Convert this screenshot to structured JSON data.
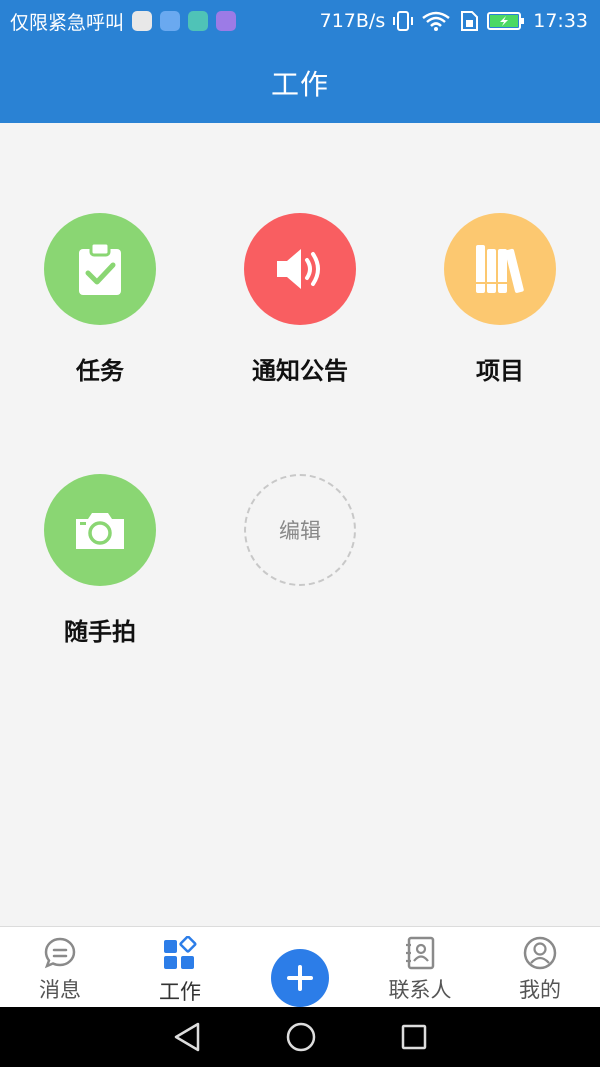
{
  "status_bar": {
    "carrier": "仅限紧急呼叫",
    "speed": "717B/s",
    "time": "17:33"
  },
  "header": {
    "title": "工作"
  },
  "grid": [
    {
      "label": "任务",
      "color": "#8ad673",
      "icon": "clipboard-check-icon"
    },
    {
      "label": "通知公告",
      "color": "#f95e61",
      "icon": "speaker-icon"
    },
    {
      "label": "项目",
      "color": "#fcc870",
      "icon": "books-icon"
    },
    {
      "label": "随手拍",
      "color": "#8ad673",
      "icon": "camera-icon"
    }
  ],
  "edit_button": {
    "label": "编辑"
  },
  "bottom_nav": [
    {
      "label": "消息",
      "icon": "chat-bubble-icon"
    },
    {
      "label": "工作",
      "icon": "apps-grid-icon",
      "active": true
    },
    {
      "label": "",
      "icon": "plus-icon"
    },
    {
      "label": "联系人",
      "icon": "contacts-book-icon"
    },
    {
      "label": "我的",
      "icon": "user-icon"
    }
  ],
  "colors": {
    "primary": "#2a82d4",
    "background": "#f4f4f4",
    "fab": "#2c7de8"
  }
}
